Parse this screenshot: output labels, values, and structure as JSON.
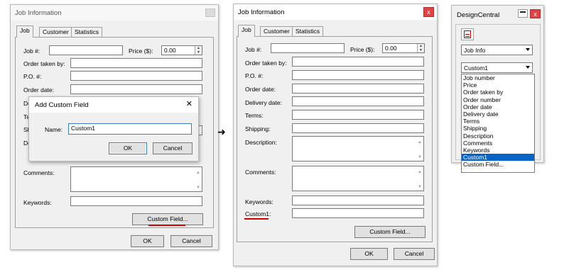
{
  "left_dialog": {
    "title": "Job Information",
    "tabs": [
      "Job",
      "Customer",
      "Statistics"
    ],
    "job_label": "Job #:",
    "price_label": "Price ($):",
    "price_value": "0.00",
    "order_taken_label": "Order taken by:",
    "po_label": "P.O. #:",
    "order_date_label": "Order date:",
    "comments_label": "Comments:",
    "keywords_label": "Keywords:",
    "custom_field_button": "Custom Field...",
    "ok_button": "OK",
    "cancel_button": "Cancel"
  },
  "add_field_dialog": {
    "title": "Add Custom Field",
    "close_glyph": "✕",
    "name_label": "Name:",
    "name_value": "Custom1",
    "ok_button": "OK",
    "cancel_button": "Cancel",
    "hidden_partial_labels": [
      "De",
      "Te",
      "Sh",
      "De"
    ]
  },
  "arrow_glyph": "➜",
  "right_dialog": {
    "title": "Job Information",
    "close_glyph": "x",
    "tabs": [
      "Job",
      "Customer",
      "Statistics"
    ],
    "job_label": "Job #:",
    "price_label": "Price ($):",
    "price_value": "0.00",
    "order_taken_label": "Order taken by:",
    "po_label": "P.O. #:",
    "order_date_label": "Order date:",
    "delivery_date_label": "Delivery date:",
    "terms_label": "Terms:",
    "shipping_label": "Shipping:",
    "description_label": "Description:",
    "comments_label": "Comments:",
    "keywords_label": "Keywords:",
    "custom1_label": "Custom1:",
    "custom_field_button": "Custom Field...",
    "ok_button": "OK",
    "cancel_button": "Cancel"
  },
  "design_central": {
    "title": "DesignCentral",
    "close_glyph": "x",
    "combo1_value": "Job Info",
    "combo2_value": "Custom1",
    "list_items": [
      "Job number",
      "Price",
      "Order taken by",
      "Order number",
      "Order date",
      "Delivery date",
      "Terms",
      "Shipping",
      "Description",
      "Comments",
      "Keywords",
      "Custom1",
      "Custom Field..."
    ],
    "selected_index": 11
  },
  "colors": {
    "accent_red": "#cc0000",
    "selection_blue": "#0a64c8",
    "close_red": "#e04343"
  }
}
